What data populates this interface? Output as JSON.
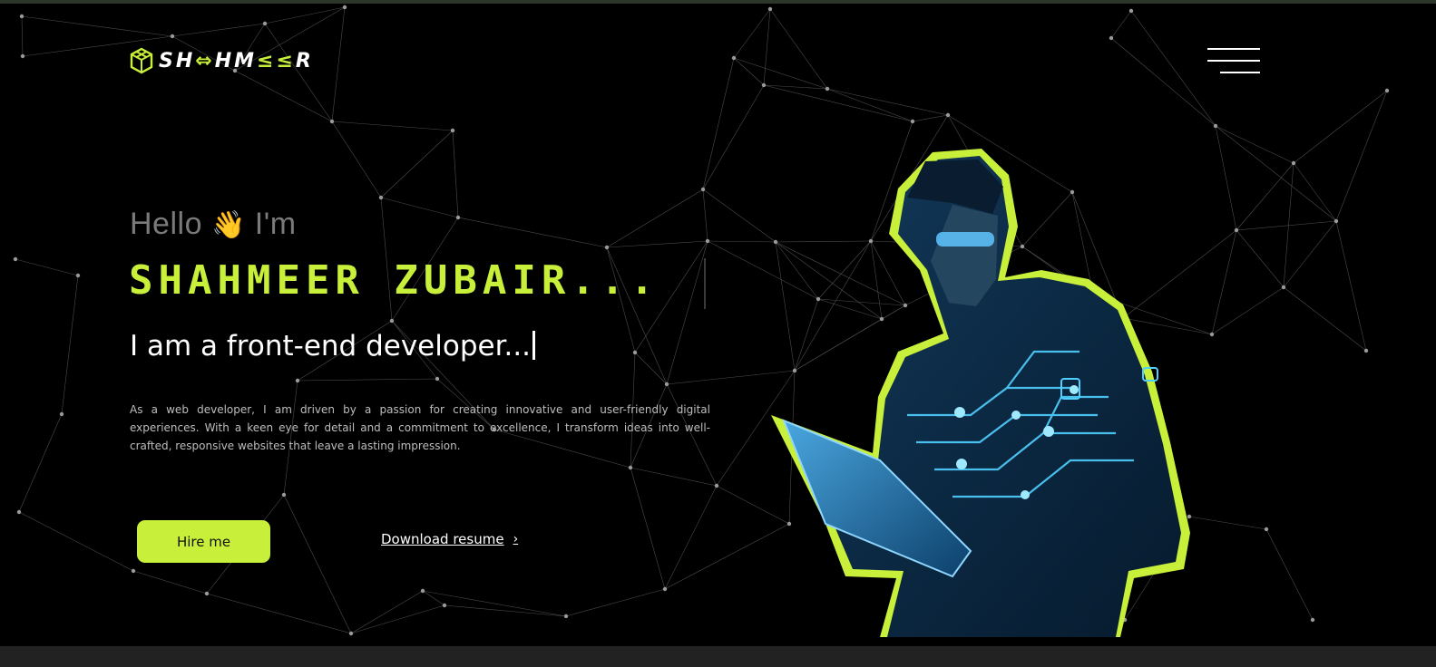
{
  "colors": {
    "accent": "#c8f03a",
    "background": "#000000",
    "muted": "#7a7a7a",
    "line": "#8a8a8a"
  },
  "logo": {
    "text_a": "SH",
    "text_b": "HM",
    "text_c": "R",
    "accent_a": "⇔",
    "accent_b": "≤≤",
    "icon": "cube-logo-icon"
  },
  "nav": {
    "menu_icon": "hamburger-menu-icon"
  },
  "hero": {
    "greeting": "Hello",
    "wave_emoji": "👋",
    "greeting_suffix": "I'm",
    "name": "SHAHMEER ZUBAIR...",
    "role": "I am a front-end developer...",
    "description": "As a web developer, I am driven by a passion for creating innovative and user-friendly digital experiences. With a keen eye for detail and a commitment to excellence, I transform ideas into well-crafted, responsive websites that leave a lasting impression.",
    "hire_label": "Hire me",
    "download_label": "Download resume",
    "download_icon": "chevron-right-icon",
    "portrait": "developer-with-tablet-illustration"
  }
}
